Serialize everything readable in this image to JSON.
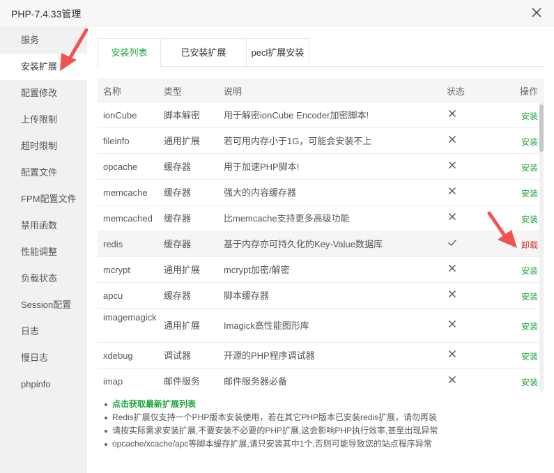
{
  "window": {
    "title": "PHP-7.4.33管理",
    "close_icon": "close-icon"
  },
  "sidebar": {
    "items": [
      {
        "label": "服务"
      },
      {
        "label": "安装扩展"
      },
      {
        "label": "配置修改"
      },
      {
        "label": "上传限制"
      },
      {
        "label": "超时限制"
      },
      {
        "label": "配置文件"
      },
      {
        "label": "FPM配置文件"
      },
      {
        "label": "禁用函数"
      },
      {
        "label": "性能调整"
      },
      {
        "label": "负载状态"
      },
      {
        "label": "Session配置"
      },
      {
        "label": "日志"
      },
      {
        "label": "慢日志"
      },
      {
        "label": "phpinfo"
      }
    ],
    "active_index": 1
  },
  "tabs": [
    {
      "label": "安装列表"
    },
    {
      "label": "已安装扩展"
    },
    {
      "label": "pecl扩展安装"
    }
  ],
  "table": {
    "headers": {
      "name": "名称",
      "type": "类型",
      "desc": "说明",
      "state": "状态",
      "op": "操作"
    },
    "rows": [
      {
        "name": "ionCube",
        "type": "脚本解密",
        "desc": "用于解密ionCube Encoder加密脚本!",
        "installed": false,
        "op": "安装"
      },
      {
        "name": "fileinfo",
        "type": "通用扩展",
        "desc": "若可用内存小于1G，可能会安装不上",
        "installed": false,
        "op": "安装"
      },
      {
        "name": "opcache",
        "type": "缓存器",
        "desc": "用于加速PHP脚本!",
        "installed": false,
        "op": "安装"
      },
      {
        "name": "memcache",
        "type": "缓存器",
        "desc": "强大的内容缓存器",
        "installed": false,
        "op": "安装"
      },
      {
        "name": "memcached",
        "type": "缓存器",
        "desc": "比memcache支持更多高级功能",
        "installed": false,
        "op": "安装"
      },
      {
        "name": "redis",
        "type": "缓存器",
        "desc": "基于内存亦可持久化的Key-Value数据库",
        "installed": true,
        "op": "卸载"
      },
      {
        "name": "mcrypt",
        "type": "通用扩展",
        "desc": "mcrypt加密/解密",
        "installed": false,
        "op": "安装"
      },
      {
        "name": "apcu",
        "type": "缓存器",
        "desc": "脚本缓存器",
        "installed": false,
        "op": "安装"
      },
      {
        "name": "imagemagick",
        "type": "通用扩展",
        "desc": "Imagick高性能图形库",
        "installed": false,
        "op": "安装"
      },
      {
        "name": "xdebug",
        "type": "调试器",
        "desc": "开源的PHP程序调试器",
        "installed": false,
        "op": "安装"
      },
      {
        "name": "imap",
        "type": "邮件服务",
        "desc": "邮件服务器必备",
        "installed": false,
        "op": "安装"
      }
    ]
  },
  "notes": [
    "点击获取最新扩展列表",
    "Redis扩展仅支持一个PHP版本安装使用，若在其它PHP版本已安装redis扩展，请勿再装",
    "请按实际需求安装扩展,不要安装不必要的PHP扩展,这会影响PHP执行效率,甚至出现异常",
    "opcache/xcache/apc等脚本缓存扩展,请只安装其中1个,否则可能导致您的站点程序异常"
  ],
  "colors": {
    "accent": "#20a53a",
    "danger": "#d0312d",
    "annotation_arrow": "#f0524f"
  },
  "icons": {
    "not_installed": "cross-icon",
    "installed": "check-icon",
    "annotation": "red-arrow-icon"
  }
}
